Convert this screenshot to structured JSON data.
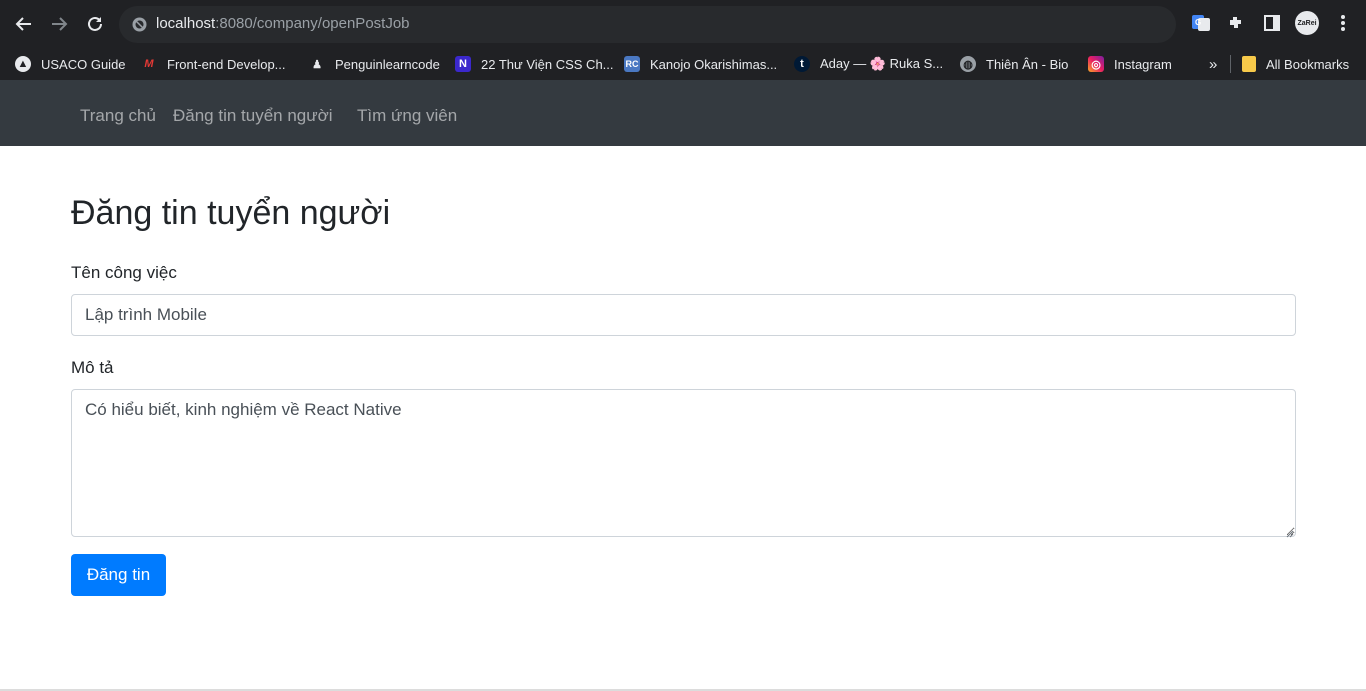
{
  "browser": {
    "url_host": "localhost",
    "url_path": ":8080/company/openPostJob",
    "bookmarks": [
      {
        "label": "USACO Guide",
        "icon": "usaco-icon"
      },
      {
        "label": "Front-end Develop...",
        "icon": "m-logo-icon"
      },
      {
        "label": "Penguinlearncode",
        "icon": "penguin-icon"
      },
      {
        "label": "22 Thư Viện CSS Ch...",
        "icon": "n-logo-icon"
      },
      {
        "label": "Kanojo Okarishimas...",
        "icon": "rc-logo-icon"
      },
      {
        "label": "Aday — 🌸 Ruka S...",
        "icon": "tumblr-icon"
      },
      {
        "label": "Thiên Ân - Bio",
        "icon": "globe-icon"
      },
      {
        "label": "Instagram",
        "icon": "instagram-icon"
      }
    ],
    "overflow_label": "»",
    "all_bookmarks_label": "All Bookmarks",
    "profile_label": "ZaRei"
  },
  "nav": {
    "items": [
      "Trang chủ",
      "Đăng tin tuyển người",
      "Tìm ứng viên"
    ]
  },
  "form": {
    "title": "Đăng tin tuyển người",
    "job_label": "Tên công việc",
    "job_value": "Lập trình Mobile",
    "desc_label": "Mô tả",
    "desc_value": "Có hiểu biết, kinh nghiệm về React Native",
    "submit_label": "Đăng tin"
  },
  "colors": {
    "navbar": "#343a40",
    "primary": "#007bff",
    "chrome": "#202124"
  }
}
